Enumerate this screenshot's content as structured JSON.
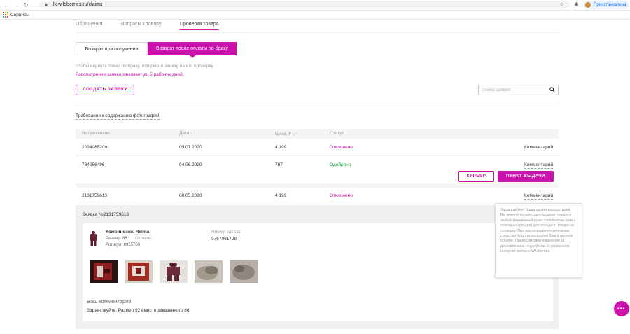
{
  "browser": {
    "url": "lk.wildberries.ru/claims",
    "profile_label": "Приостановлена",
    "bookmarks_label": "Сервисы"
  },
  "top_tabs": [
    "Обращения",
    "Вопросы к товару",
    "Проверка товара"
  ],
  "segment": {
    "left": "Возврат при получении",
    "right": "Возврат после оплаты по браку"
  },
  "info": {
    "line1": "Чтобы вернуть товар по браку, оформите заявку на его проверку.",
    "line2": "Рассмотрение заявки занимает до 5 рабочих дней."
  },
  "create_button": "СОЗДАТЬ ЗАЯВКУ",
  "search_placeholder": "Поиск заявки",
  "photo_requirements": "Требования к содержанию фотографий",
  "table": {
    "headers": [
      "№ претензии",
      "Дата ↓↑",
      "Цена, ₽ ↓↑",
      "Статус"
    ],
    "rows": [
      {
        "id": "2034085209",
        "date": "05.07.2020",
        "price": "4 199",
        "status": "Отклонено",
        "comment": "Комментарий"
      },
      {
        "id": "784956496",
        "date": "04.06.2020",
        "price": "787",
        "status": "Одобрено",
        "comment": "Комментарий"
      },
      {
        "id": "2131759613",
        "date": "08.05.2020",
        "price": "4 199",
        "status": "Отклонено",
        "comment": "Комментарий"
      }
    ]
  },
  "actions": {
    "courier": "КУРЬЕР",
    "pickup": "ПУНКТ ВЫДАЧИ"
  },
  "claim": {
    "title": "Заявка №2131759613",
    "product_name": "Комбинезон, Reima",
    "size": "Размер: 86",
    "shade": "Оттенок:",
    "article": "Артикул: 8355760",
    "order_label": "Номер заказа",
    "order_number": "9767061728",
    "comment_heading": "Ваш комментарий",
    "comment_text": "Здравствуйте. Размер 92 вместо заказанного 86."
  },
  "tooltip": "Здравствуйте! Ваша заявка рассмотрена. Вы можете осуществить возврат товара в любой фирменный пункт самовывоза (или с помощью курьера) для передачи товара на проверку. При подтверждении денежные средства будут возвращены Вам в полном объеме. Приносим свои извинения за доставленные неудобства. С уважением, интернет-магазин Wildberries.",
  "colors": {
    "accent": "#cb11ab",
    "approved": "#19a43a"
  }
}
